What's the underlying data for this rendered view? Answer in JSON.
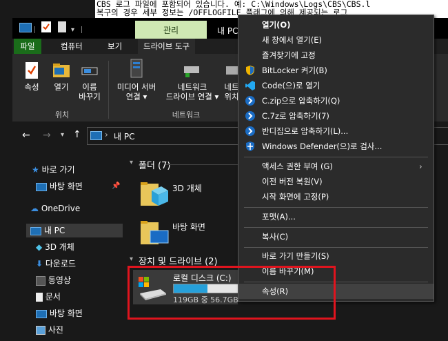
{
  "console": {
    "line1": "CBS 로그 파일에 포함되어 있습니다. 예: C:\\Windows\\Logs\\CBS\\CBS.l",
    "line2": "복구의 경우 세부 정보는 /OFFLOGFILE 플래그에 의해 제공되는 로그"
  },
  "window": {
    "title": "내 PC",
    "context_tab": "관리"
  },
  "ribbon": {
    "tabs": [
      "파일",
      "컴퓨터",
      "보기",
      "드라이브 도구"
    ],
    "buttons": {
      "properties": "속성",
      "open": "열기",
      "rename_1": "이름",
      "rename_2": "바꾸기",
      "media_1": "미디어 서버",
      "media_2": "연결 ▾",
      "netdrive_1": "네트워크",
      "netdrive_2": "드라이브 연결 ▾",
      "netloc_1": "네트",
      "netloc_2": "위치"
    },
    "groups": {
      "location": "위치",
      "network": "네트워크"
    }
  },
  "address": {
    "path": "내 PC",
    "sep": "›"
  },
  "sidebar": {
    "items": [
      {
        "label": "바로 가기",
        "icon": "star-icon"
      },
      {
        "label": "바탕 화면",
        "icon": "desktop-icon"
      },
      {
        "label": "OneDrive",
        "icon": "cloud-icon"
      },
      {
        "label": "내 PC",
        "icon": "pc-icon"
      },
      {
        "label": "3D 개체",
        "icon": "cube-icon"
      },
      {
        "label": "다운로드",
        "icon": "download-icon"
      },
      {
        "label": "동영상",
        "icon": "video-icon"
      },
      {
        "label": "문서",
        "icon": "document-icon"
      },
      {
        "label": "바탕 화면",
        "icon": "desktop-icon"
      },
      {
        "label": "사진",
        "icon": "picture-icon"
      }
    ]
  },
  "content": {
    "folders_header": "폴더 (7)",
    "folders": [
      "3D 개체",
      "바탕 화면"
    ],
    "drives_header": "장치 및 드라이브 (2)",
    "drive": {
      "name": "로컬 디스크 (C:)",
      "space": "119GB 중 56.7GB",
      "used_fraction": 0.52
    }
  },
  "context_menu": {
    "items": [
      {
        "label": "열기(O)",
        "bold": true
      },
      {
        "label": "새 창에서 열기(E)"
      },
      {
        "label": "즐겨찾기에 고정"
      },
      {
        "label": "BitLocker 켜기(B)",
        "icon": "shield-icon"
      },
      {
        "label": "Code(으)로 열기",
        "icon": "vscode-icon"
      },
      {
        "label": "C.zip으로 압축하기(Q)",
        "icon": "bandizip-icon"
      },
      {
        "label": "C.7z로 압축하기(7)",
        "icon": "bandizip-icon"
      },
      {
        "label": "반디집으로 압축하기(L)...",
        "icon": "bandizip-icon"
      },
      {
        "label": "Windows Defender(으)로 검사...",
        "icon": "defender-icon"
      },
      {
        "label": "액세스 권한 부여 (G)",
        "submenu": true
      },
      {
        "label": "이전 버전 복원(V)"
      },
      {
        "label": "시작 화면에 고정(P)"
      },
      {
        "label": "포맷(A)..."
      },
      {
        "label": "복사(C)"
      },
      {
        "label": "바로 가기 만들기(S)"
      },
      {
        "label": "이름 바꾸기(M)"
      },
      {
        "label": "속성(R)",
        "hovered": true
      }
    ]
  },
  "colors": {
    "highlight": "#e0141e",
    "context_tab": "#cfe8b3",
    "accent": "#26a0da"
  }
}
